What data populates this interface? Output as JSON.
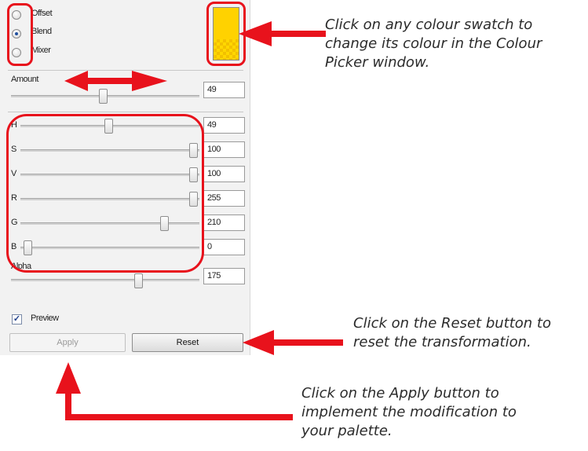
{
  "mode_options": [
    {
      "label": "Offset",
      "selected": false
    },
    {
      "label": "Blend",
      "selected": true
    },
    {
      "label": "Mixer",
      "selected": false
    }
  ],
  "swatch": {
    "color": "#ffd200"
  },
  "amount": {
    "label": "Amount",
    "value": "49",
    "max": 100
  },
  "channels": [
    {
      "label": "H",
      "value": "49",
      "max": 100
    },
    {
      "label": "S",
      "value": "100",
      "max": 100
    },
    {
      "label": "V",
      "value": "100",
      "max": 100
    },
    {
      "label": "R",
      "value": "255",
      "max": 255
    },
    {
      "label": "G",
      "value": "210",
      "max": 255
    },
    {
      "label": "B",
      "value": "0",
      "max": 255
    }
  ],
  "alpha": {
    "label": "Alpha",
    "value": "175",
    "max": 255
  },
  "preview": {
    "label": "Preview",
    "checked": true,
    "check_glyph": "✓"
  },
  "buttons": {
    "apply": "Apply",
    "reset": "Reset"
  },
  "notes": {
    "swatch": [
      "Click on any colour swatch to",
      "change its colour in the Colour",
      "Picker window."
    ],
    "reset": [
      "Click on the Reset button to",
      "reset the transformation."
    ],
    "apply": [
      "Click on the Apply button to",
      "implement the modification to",
      "your palette."
    ]
  },
  "annotation_color": "#e8121c"
}
